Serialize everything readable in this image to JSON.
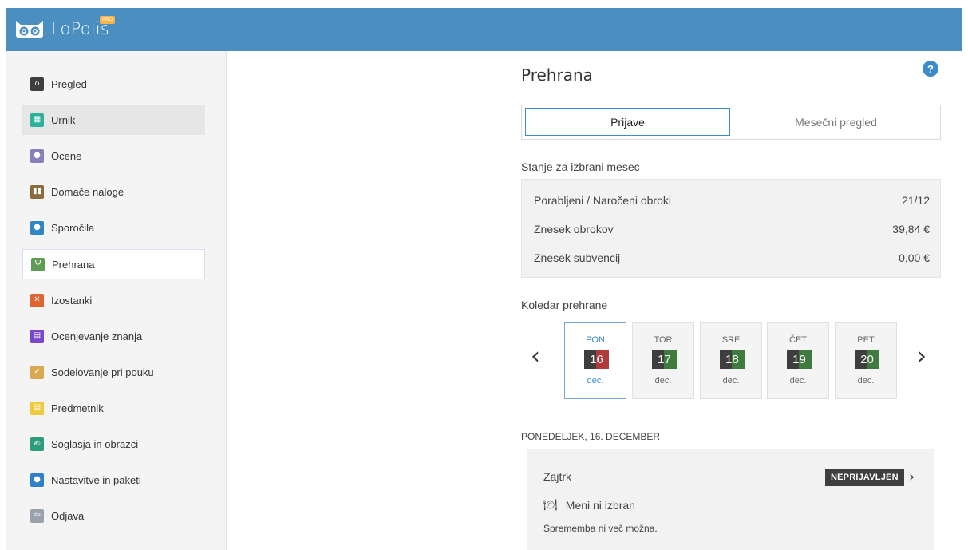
{
  "app": {
    "name": "LoPolis",
    "badge": "PRO",
    "colors": {
      "header": "#4a8fc0",
      "accent": "#3d8cc9"
    }
  },
  "sidebar": {
    "items": [
      {
        "label": "Pregled",
        "icon": "home-icon",
        "icon_glyph": "⌂",
        "color": "#3e3e3e"
      },
      {
        "label": "Urnik",
        "icon": "calendar-icon",
        "icon_glyph": "▦",
        "color": "#2fb09a"
      },
      {
        "label": "Ocene",
        "icon": "grade-icon",
        "icon_glyph": "●",
        "color": "#8a7fb8"
      },
      {
        "label": "Domače naloge",
        "icon": "book-icon",
        "icon_glyph": "▮▮",
        "color": "#8b6a3e"
      },
      {
        "label": "Sporočila",
        "icon": "message-icon",
        "icon_glyph": "●",
        "color": "#2f86c2"
      },
      {
        "label": "Prehrana",
        "icon": "cutlery-icon",
        "icon_glyph": "Ψ",
        "color": "#5f9b55"
      },
      {
        "label": "Izostanki",
        "icon": "absence-calendar-icon",
        "icon_glyph": "✕",
        "color": "#e0642f"
      },
      {
        "label": "Ocenjevanje znanja",
        "icon": "assessment-icon",
        "icon_glyph": "▤",
        "color": "#7a49c9"
      },
      {
        "label": "Sodelovanje pri pouku",
        "icon": "check-circle-icon",
        "icon_glyph": "✓",
        "color": "#d9a853"
      },
      {
        "label": "Predmetnik",
        "icon": "document-icon",
        "icon_glyph": "▤",
        "color": "#f0c93c"
      },
      {
        "label": "Soglasja in obrazci",
        "icon": "signature-icon",
        "icon_glyph": "✍",
        "color": "#2c9c7d"
      },
      {
        "label": "Nastavitve in paketi",
        "icon": "user-icon",
        "icon_glyph": "●",
        "color": "#2f80c8"
      },
      {
        "label": "Odjava",
        "icon": "logout-icon",
        "icon_glyph": "⇦",
        "color": "#9aa3ad"
      }
    ],
    "active_index": 1,
    "selected_index": 5
  },
  "main": {
    "title": "Prehrana",
    "help": "?",
    "tabs": [
      {
        "label": "Prijave",
        "active": true
      },
      {
        "label": "Mesečni pregled",
        "active": false
      }
    ],
    "stats_heading": "Stanje za izbrani mesec",
    "stats": [
      {
        "label": "Porabljeni / Naročeni obroki",
        "value": "21/12"
      },
      {
        "label": "Znesek obrokov",
        "value": "39,84 €"
      },
      {
        "label": "Znesek subvencij",
        "value": "0,00 €"
      }
    ],
    "calendar_heading": "Koledar prehrane",
    "prev": "‹",
    "next": "›",
    "days": [
      {
        "name": "PON",
        "num": "16",
        "month": "dec.",
        "selected": true,
        "status": "red"
      },
      {
        "name": "TOR",
        "num": "17",
        "month": "dec.",
        "selected": false,
        "status": "green"
      },
      {
        "name": "SRE",
        "num": "18",
        "month": "dec.",
        "selected": false,
        "status": "green"
      },
      {
        "name": "ČET",
        "num": "19",
        "month": "dec.",
        "selected": false,
        "status": "green"
      },
      {
        "name": "PET",
        "num": "20",
        "month": "dec.",
        "selected": false,
        "status": "green"
      }
    ],
    "status_colors": {
      "red": "#b33a3a",
      "green": "#3f7a3f",
      "dark": "#3e3e3e"
    },
    "date_heading": "PONEDELJEK, 16. DECEMBER",
    "meal": {
      "title": "Zajtrk",
      "badge": "NEPRIJAVLJEN",
      "chevron": "›",
      "menu_icon": "plate-icon",
      "menu_glyph": "🍽",
      "menu": "Meni ni izbran",
      "note": "Sprememba ni več možna."
    }
  }
}
